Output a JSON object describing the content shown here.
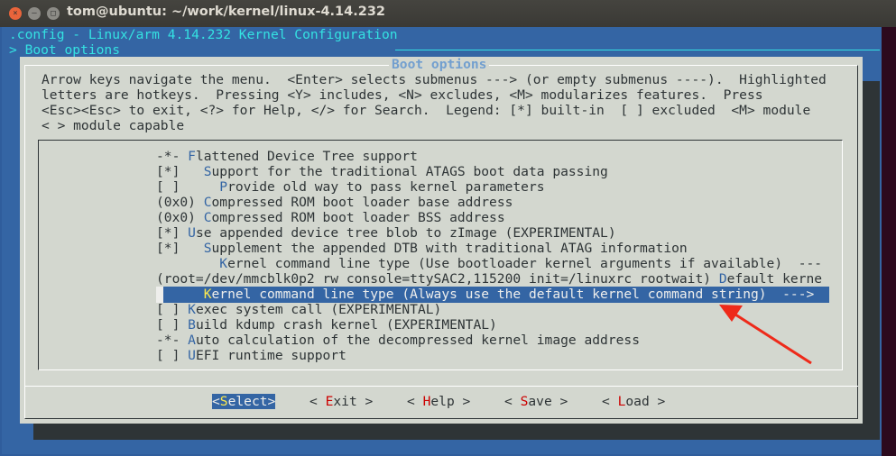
{
  "window": {
    "title": "tom@ubuntu: ~/work/kernel/linux-4.14.232"
  },
  "header": {
    "line1": ".config - Linux/arm 4.14.232 Kernel Configuration",
    "line2": "> Boot options"
  },
  "dialog": {
    "title": "Boot options",
    "help": [
      "Arrow keys navigate the menu.  <Enter> selects submenus ---> (or empty submenus ----).  Highlighted",
      "letters are hotkeys.  Pressing <Y> includes, <N> excludes, <M> modularizes features.  Press",
      "<Esc><Esc> to exit, <?> for Help, </> for Search.  Legend: [*] built-in  [ ] excluded  <M> module",
      "< > module capable"
    ]
  },
  "menu": [
    {
      "pre": "-*- ",
      "hot": "F",
      "post": "lattened Device Tree support"
    },
    {
      "pre": "[*]   ",
      "hot": "S",
      "post": "upport for the traditional ATAGS boot data passing"
    },
    {
      "pre": "[ ]     ",
      "hot": "P",
      "post": "rovide old way to pass kernel parameters"
    },
    {
      "pre": "(0x0) ",
      "hot": "C",
      "post": "ompressed ROM boot loader base address"
    },
    {
      "pre": "(0x0) ",
      "hot": "C",
      "post": "ompressed ROM boot loader BSS address"
    },
    {
      "pre": "[*] ",
      "hot": "U",
      "post": "se appended device tree blob to zImage (EXPERIMENTAL)"
    },
    {
      "pre": "[*]   ",
      "hot": "S",
      "post": "upplement the appended DTB with traditional ATAG information"
    },
    {
      "pre": "        ",
      "hot": "K",
      "post": "ernel command line type (Use bootloader kernel arguments if available)  ---"
    },
    {
      "pre": "(root=/dev/mmcblk0p2 rw console=ttySAC2,115200 init=/linuxrc rootwait) ",
      "hot": "D",
      "post": "efault kerne"
    },
    {
      "pre": "      ",
      "hot": "K",
      "post": "ernel command line type (Always use the default kernel command string)  --->",
      "selected": true
    },
    {
      "pre": "[ ] ",
      "hot": "K",
      "post": "exec system call (EXPERIMENTAL)"
    },
    {
      "pre": "[ ] ",
      "hot": "B",
      "post": "uild kdump crash kernel (EXPERIMENTAL)"
    },
    {
      "pre": "-*- ",
      "hot": "A",
      "post": "uto calculation of the decompressed kernel image address"
    },
    {
      "pre": "[ ] ",
      "hot": "U",
      "post": "EFI runtime support"
    }
  ],
  "buttons": [
    {
      "l": "<",
      "h": "S",
      "r": "elect>"
    },
    {
      "l": "< ",
      "h": "E",
      "r": "xit >"
    },
    {
      "l": "< ",
      "h": "H",
      "r": "elp >"
    },
    {
      "l": "< ",
      "h": "S",
      "r": "ave >"
    },
    {
      "l": "< ",
      "h": "L",
      "r": "oad >"
    }
  ],
  "colors": {
    "terminal_bg": "#3465a4",
    "dialog_bg": "#d3d7cf",
    "hotkey": "#3465a4",
    "annotation_arrow": "#ee2a1a"
  }
}
